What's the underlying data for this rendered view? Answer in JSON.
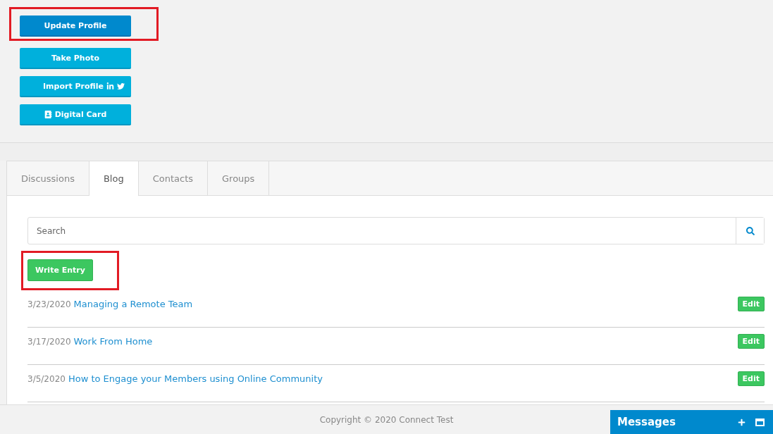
{
  "profile_buttons": [
    {
      "label": "Update Profile",
      "kind": "primary",
      "highlighted": true
    },
    {
      "label": "Take Photo",
      "kind": "plain",
      "highlighted": false
    },
    {
      "label": "Import Profile",
      "kind": "social",
      "highlighted": false
    },
    {
      "label": "Digital Card",
      "kind": "card",
      "highlighted": false
    }
  ],
  "tabs": [
    {
      "label": "Discussions",
      "selected": false
    },
    {
      "label": "Blog",
      "selected": true
    },
    {
      "label": "Contacts",
      "selected": false
    },
    {
      "label": "Groups",
      "selected": false
    }
  ],
  "search": {
    "placeholder": "Search"
  },
  "write_entry": {
    "label": "Write Entry",
    "highlighted": true
  },
  "entries": [
    {
      "date": "3/23/2020",
      "title": "Managing a Remote Team",
      "action": "Edit"
    },
    {
      "date": "3/17/2020",
      "title": "Work From Home",
      "action": "Edit"
    },
    {
      "date": "3/5/2020",
      "title": "How to Engage your Members using Online Community",
      "action": "Edit"
    }
  ],
  "footer": {
    "copyright": "Copyright © 2020 Connect Test"
  },
  "messages": {
    "title": "Messages"
  }
}
